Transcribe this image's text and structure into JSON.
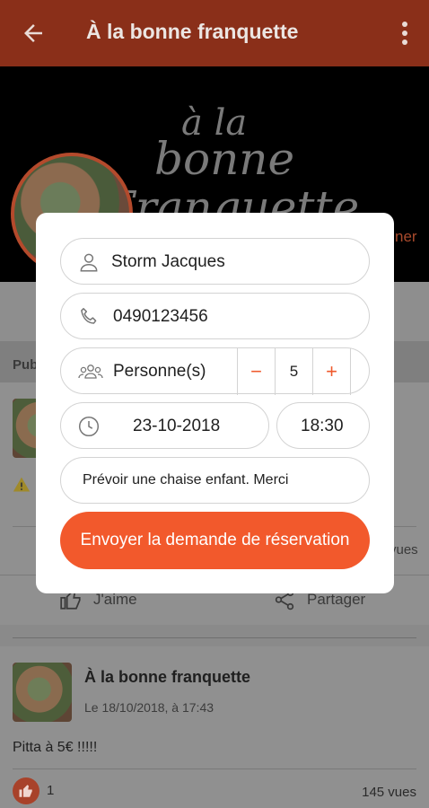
{
  "appbar": {
    "title": "À la bonne franquette"
  },
  "cover": {
    "logo_line1": "à la",
    "logo_line2": "bonne",
    "logo_line3": "Franquette",
    "follow_fragment": "ner"
  },
  "feed_background": {
    "section_fragment": "Pub",
    "views_fragment": "vues",
    "warning_icon": "warning-icon",
    "actions": {
      "like_label": "J'aime",
      "share_label": "Partager"
    }
  },
  "post": {
    "title": "À la bonne franquette",
    "date": "Le 18/10/2018, à 17:43",
    "text": "Pitta à 5€ !!!!!",
    "like_count": "1",
    "views": "145 vues"
  },
  "reservation_form": {
    "name_value": "Storm Jacques",
    "phone_value": "0490123456",
    "persons_label": "Personne(s)",
    "persons_count": "5",
    "minus_label": "−",
    "plus_label": "+",
    "date_value": "23-10-2018",
    "time_value": "18:30",
    "note_value": "Prévoir une chaise enfant. Merci",
    "submit_label": "Envoyer la demande de réservation"
  },
  "colors": {
    "appbar_dimmed": "#8a2f19",
    "accent": "#f2592c",
    "modal_bg": "#ffffff"
  }
}
